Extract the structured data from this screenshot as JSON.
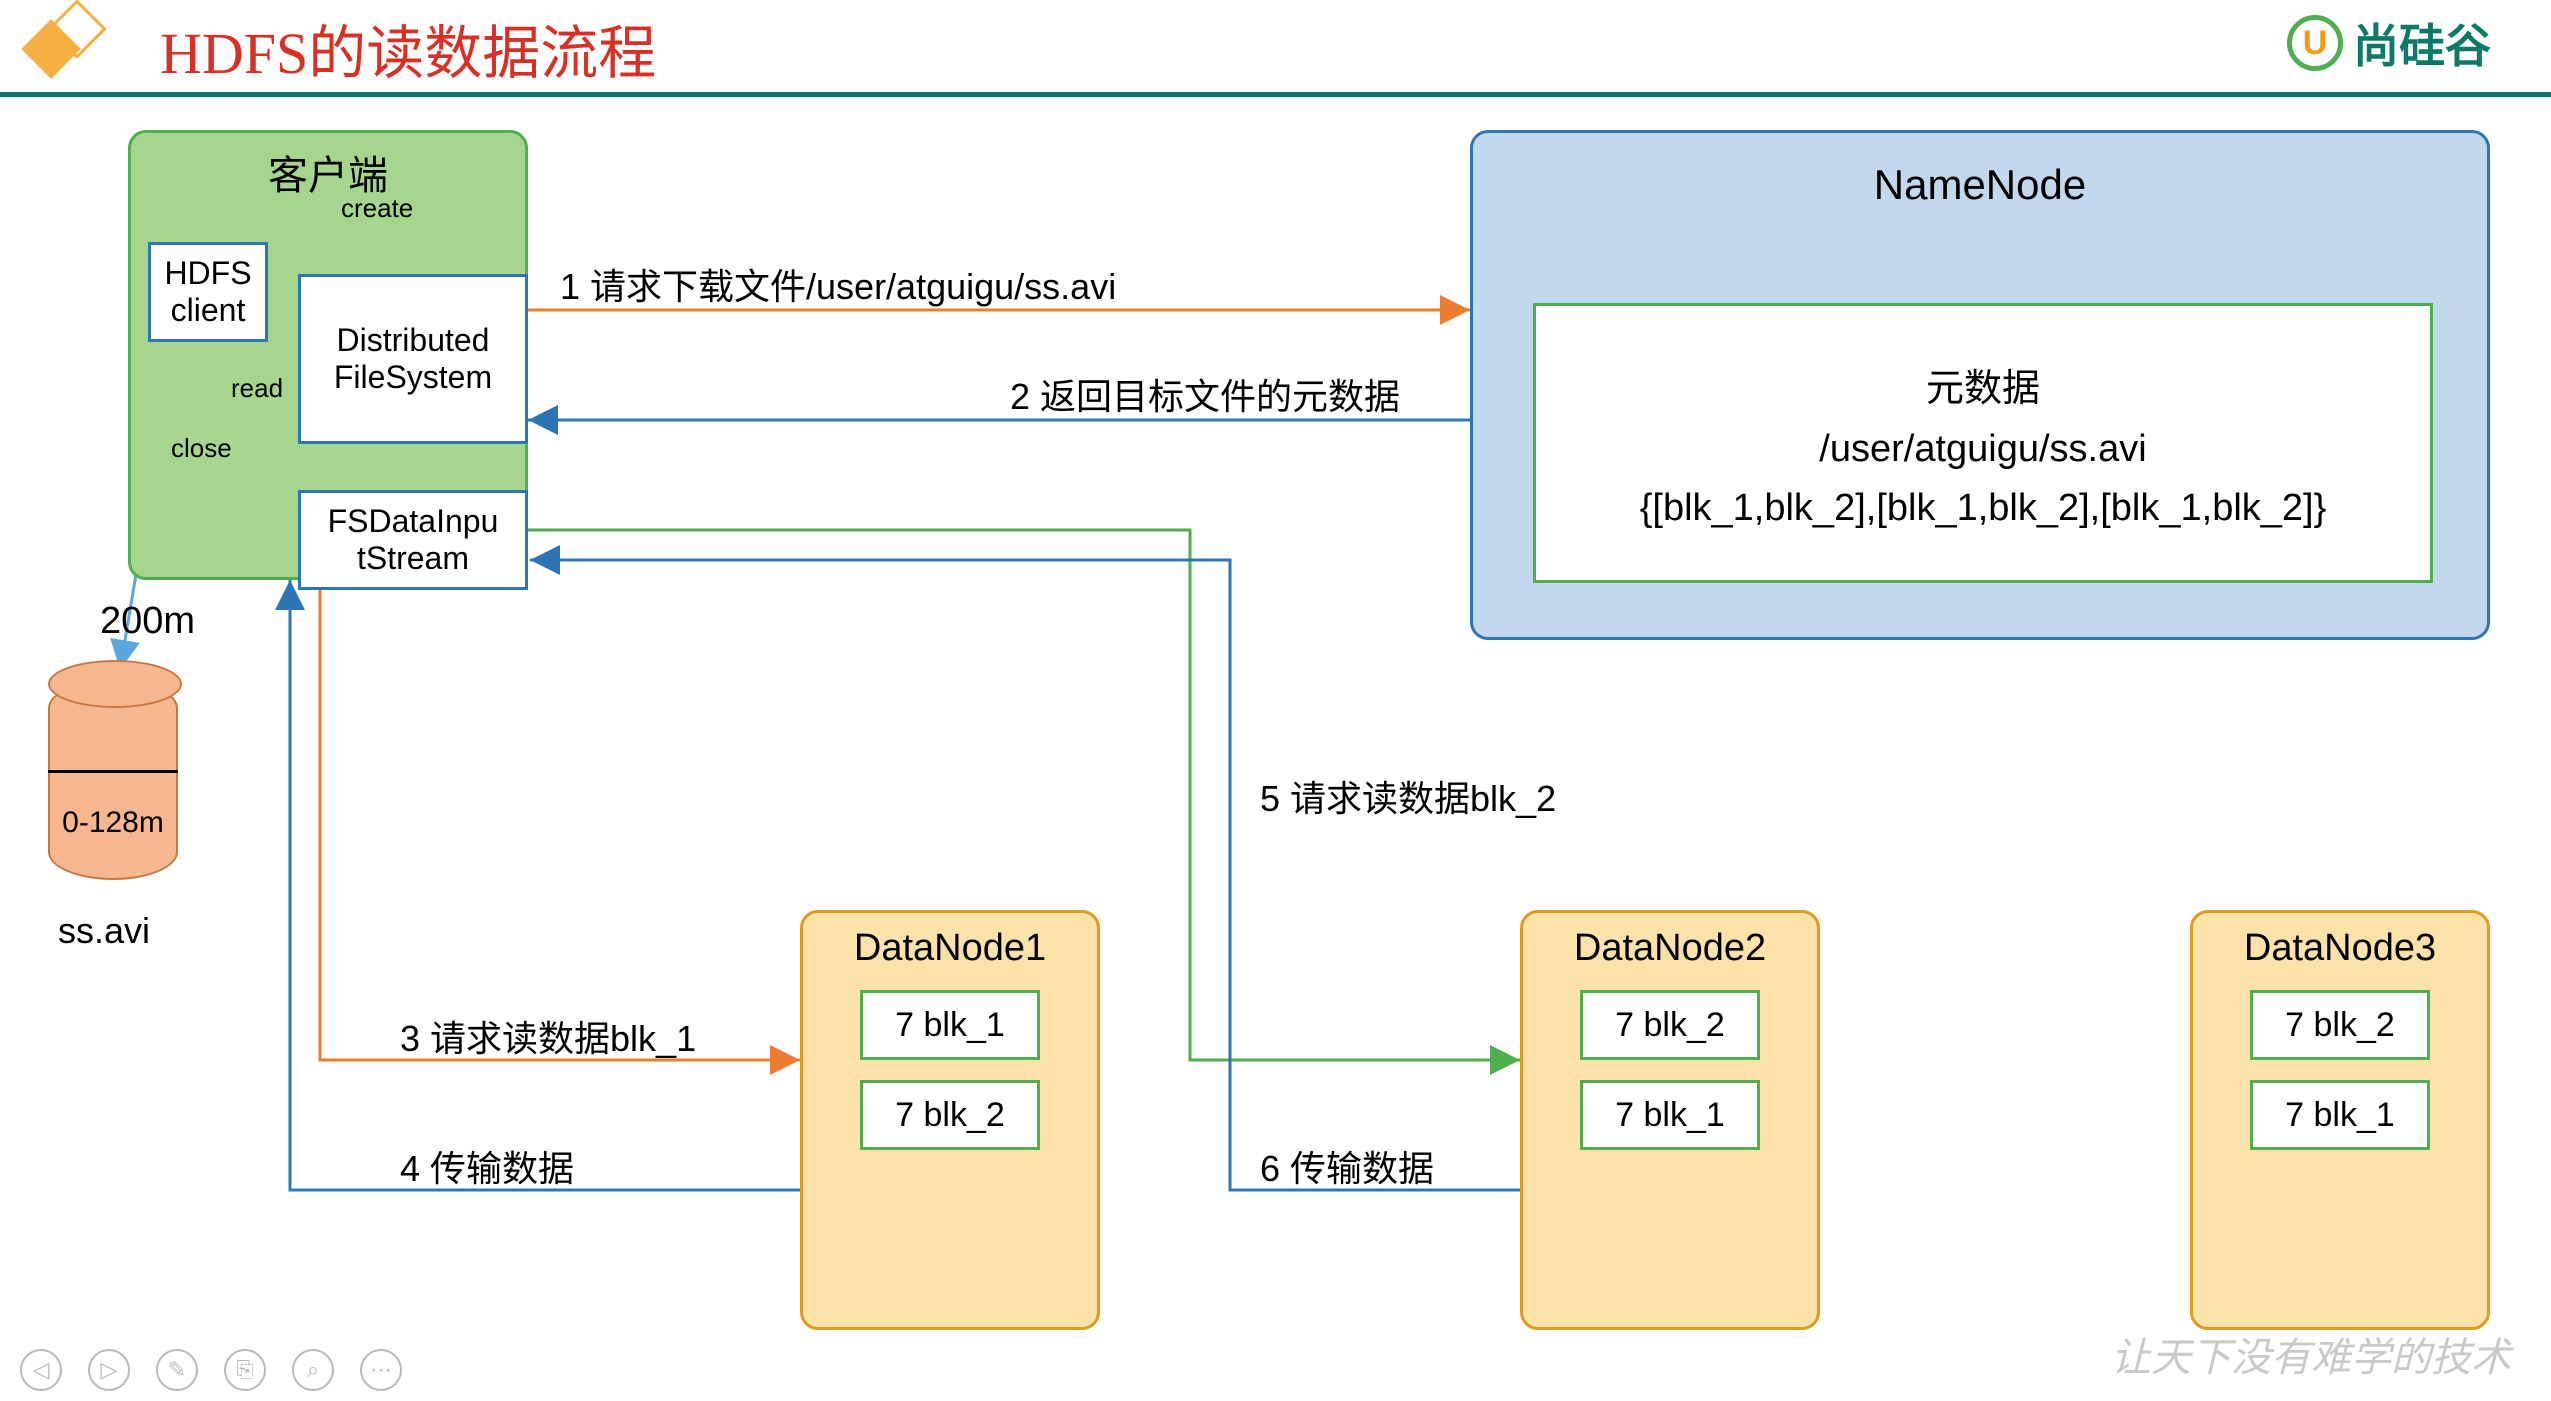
{
  "header": {
    "title": "HDFS的读数据流程",
    "brand": "尚硅谷"
  },
  "client": {
    "title": "客户端",
    "create_label": "create",
    "read_label": "read",
    "close_label": "close",
    "hdfs_client": "HDFS\nclient",
    "dfs": "Distributed\nFileSystem",
    "fsdis": "FSDataInpu\ntStream",
    "size": "200m"
  },
  "cylinder": {
    "range": "0-128m",
    "caption": "ss.avi"
  },
  "namenode": {
    "title": "NameNode",
    "meta_title": "元数据",
    "path": "/user/atguigu/ss.avi",
    "blocks": "{[blk_1,blk_2],[blk_1,blk_2],[blk_1,blk_2]}"
  },
  "datanodes": [
    {
      "title": "DataNode1",
      "blocks": [
        "7 blk_1",
        "7 blk_2"
      ]
    },
    {
      "title": "DataNode2",
      "blocks": [
        "7 blk_2",
        "7 blk_1"
      ]
    },
    {
      "title": "DataNode3",
      "blocks": [
        "7 blk_2",
        "7 blk_1"
      ]
    }
  ],
  "edges": {
    "e1": "1 请求下载文件/user/atguigu/ss.avi",
    "e2": "2 返回目标文件的元数据",
    "e3": "3 请求读数据blk_1",
    "e4": "4 传输数据",
    "e5": "5 请求读数据blk_2",
    "e6": "6 传输数据"
  },
  "footer": {
    "slogan": "让天下没有难学的技术"
  },
  "toolbar": [
    "◁",
    "▷",
    "✎",
    "⎘",
    "⌕",
    "⋯"
  ]
}
